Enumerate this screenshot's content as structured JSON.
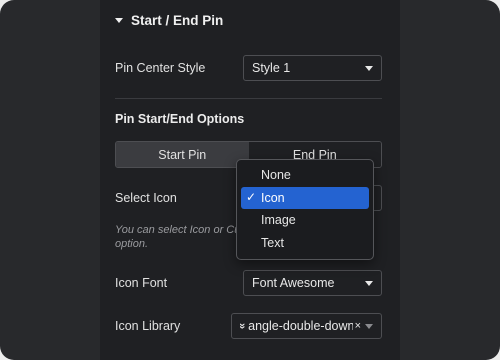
{
  "section": {
    "title": "Start / End Pin"
  },
  "pin_center_style": {
    "label": "Pin Center Style",
    "value": "Style 1"
  },
  "options": {
    "heading": "Pin Start/End Options",
    "tabs": [
      {
        "label": "Start Pin",
        "active": true
      },
      {
        "label": "End Pin",
        "active": false
      }
    ]
  },
  "select_icon": {
    "label": "Select Icon",
    "help_line1": "You can select Icon or Cu",
    "help_line2": "option.",
    "dropdown_options": [
      {
        "label": "None",
        "selected": false
      },
      {
        "label": "Icon",
        "selected": true
      },
      {
        "label": "Image",
        "selected": false
      },
      {
        "label": "Text",
        "selected": false
      }
    ],
    "check_glyph": "✓"
  },
  "icon_font": {
    "label": "Icon Font",
    "value": "Font Awesome"
  },
  "icon_library": {
    "label": "Icon Library",
    "value": "angle-double-down",
    "icon_glyph": "»",
    "clear_glyph": "×",
    "icon": "angle-double-down-icon"
  },
  "colors": {
    "accent": "#2463d1",
    "panel": "#1f2023",
    "frame": "#28292c"
  }
}
